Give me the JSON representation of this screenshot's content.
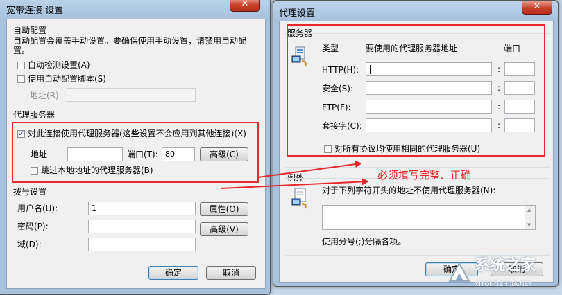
{
  "left_dialog": {
    "title": "宽带连接 设置",
    "close_glyph": "✕",
    "auto_config": {
      "legend": "自动配置",
      "description_line1": "自动配置会覆盖手动设置。要确保使用手动设置，请禁用自动配",
      "description_line2": "置。",
      "auto_detect_label": "自动检测设置(A)",
      "auto_script_label": "使用自动配置脚本(S)",
      "address_label": "地址(R)",
      "address_value": ""
    },
    "proxy": {
      "legend": "代理服务器",
      "use_proxy_label": "对此连接使用代理服务器(这些设置不会应用到其他连接)(X)",
      "address_label": "地址",
      "address_value": "",
      "port_label": "端口(T):",
      "port_value": "80",
      "advanced_button": "高级(C)",
      "bypass_local_label": "跳过本地地址的代理服务器(B)"
    },
    "dialup": {
      "legend": "拨号设置",
      "username_label": "用户名(U):",
      "username_value": "1",
      "password_label": "密码(P):",
      "password_value": "",
      "domain_label": "域(D):",
      "domain_value": "",
      "properties_button": "属性(O)",
      "advanced_button": "高级(V)"
    },
    "ok_button": "确定",
    "cancel_button": "取消"
  },
  "right_dialog": {
    "title": "代理设置",
    "close_glyph": "✕",
    "servers": {
      "legend": "服务器",
      "col_type": "类型",
      "col_address": "要使用的代理服务器地址",
      "col_port": "端口",
      "rows": [
        {
          "label": "HTTP(H):",
          "address": "",
          "port": ""
        },
        {
          "label": "安全(S):",
          "address": "",
          "port": ""
        },
        {
          "label": "FTP(F):",
          "address": "",
          "port": ""
        },
        {
          "label": "套接字(C):",
          "address": "",
          "port": ""
        }
      ],
      "colon": ":",
      "same_proxy_label": "对所有协议均使用相同的代理服务器(U)"
    },
    "exceptions": {
      "legend": "例外",
      "description": "对于下列字符开头的地址不使用代理服务器(N):",
      "value": "",
      "hint": "使用分号(;)分隔各项。"
    },
    "ok_button": "确定",
    "cancel_button": "取消"
  },
  "annotation": {
    "text": "必须填写完整、正确",
    "color": "#e8272a"
  },
  "watermark": {
    "brand": "系统之家",
    "url": "XITONGZHIJIA.NET"
  }
}
